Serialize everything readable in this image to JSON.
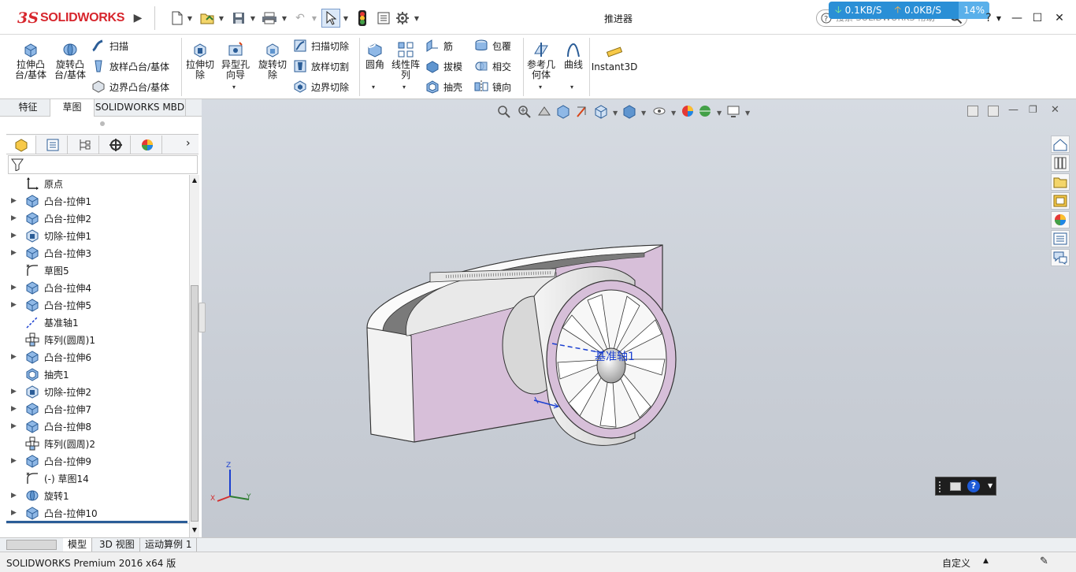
{
  "app": {
    "logo_ds": "3S",
    "logo_text": "SOLIDWORKS",
    "document_title": "推进器"
  },
  "search": {
    "placeholder": "搜索 SOLIDWORKS 帮助"
  },
  "network": {
    "down": "0.1KB/S",
    "up": "0.0KB/S",
    "cpu": "14%"
  },
  "ribbon": {
    "extrude_boss": "拉伸凸\n台/基体",
    "revolve_boss": "旋转凸\n台/基体",
    "sweep": "扫描",
    "loft_boss": "放样凸台/基体",
    "boundary_boss": "边界凸台/基体",
    "extrude_cut": "拉伸切\n除",
    "hole_wizard": "异型孔\n向导",
    "revolve_cut": "旋转切\n除",
    "sweep_cut": "扫描切除",
    "loft_cut": "放样切割",
    "boundary_cut": "边界切除",
    "fillet": "圆角",
    "linear_pattern": "线性阵\n列",
    "rib": "筋",
    "draft": "拔模",
    "shell": "抽壳",
    "wrap": "包覆",
    "intersect": "相交",
    "mirror": "镜向",
    "ref_geometry": "参考几\n何体",
    "curves": "曲线",
    "instant3d": "Instant3D"
  },
  "panel_tabs": [
    "特征",
    "草图",
    "SOLIDWORKS MBD"
  ],
  "tree": [
    {
      "label": "原点",
      "icon": "origin-icon",
      "expand": false
    },
    {
      "label": "凸台-拉伸1",
      "icon": "boss-extrude-icon",
      "expand": true
    },
    {
      "label": "凸台-拉伸2",
      "icon": "boss-extrude-icon",
      "expand": true
    },
    {
      "label": "切除-拉伸1",
      "icon": "cut-extrude-icon",
      "expand": true
    },
    {
      "label": "凸台-拉伸3",
      "icon": "boss-extrude-icon",
      "expand": true
    },
    {
      "label": "草图5",
      "icon": "sketch-icon",
      "expand": false
    },
    {
      "label": "凸台-拉伸4",
      "icon": "boss-extrude-icon",
      "expand": true
    },
    {
      "label": "凸台-拉伸5",
      "icon": "boss-extrude-icon",
      "expand": true
    },
    {
      "label": "基准轴1",
      "icon": "axis-icon",
      "expand": false
    },
    {
      "label": "阵列(圆周)1",
      "icon": "circular-pattern-icon",
      "expand": false
    },
    {
      "label": "凸台-拉伸6",
      "icon": "boss-extrude-icon",
      "expand": true
    },
    {
      "label": "抽壳1",
      "icon": "shell-icon",
      "expand": false
    },
    {
      "label": "切除-拉伸2",
      "icon": "cut-extrude-icon",
      "expand": true
    },
    {
      "label": "凸台-拉伸7",
      "icon": "boss-extrude-icon",
      "expand": true
    },
    {
      "label": "凸台-拉伸8",
      "icon": "boss-extrude-icon",
      "expand": true
    },
    {
      "label": "阵列(圆周)2",
      "icon": "circular-pattern-icon",
      "expand": false
    },
    {
      "label": "凸台-拉伸9",
      "icon": "boss-extrude-icon",
      "expand": true
    },
    {
      "label": "(-) 草图14",
      "icon": "sketch-icon",
      "expand": false
    },
    {
      "label": "旋转1",
      "icon": "revolve-icon",
      "expand": true
    },
    {
      "label": "凸台-拉伸10",
      "icon": "boss-extrude-icon",
      "expand": true
    }
  ],
  "bottom_tabs": [
    "模型",
    "3D 视图",
    "运动算例 1"
  ],
  "status": {
    "app_name": "SOLIDWORKS Premium 2016 x64 版",
    "units": "自定义"
  },
  "viewport": {
    "axis_label": "基准轴1",
    "triad": {
      "x": "X",
      "y": "Y",
      "z": "Z"
    }
  }
}
